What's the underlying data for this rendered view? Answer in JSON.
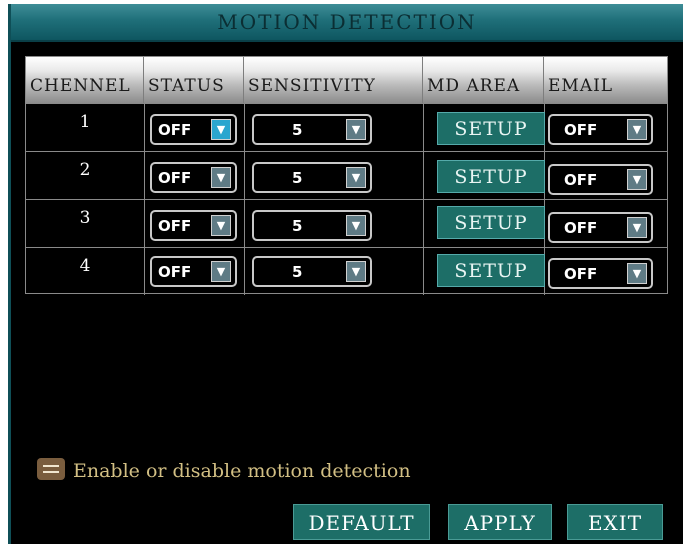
{
  "window": {
    "title": "MOTION DETECTION"
  },
  "table": {
    "columns": [
      "CHENNEL",
      "STATUS",
      "SENSITIVITY",
      "MD AREA",
      "EMAIL"
    ],
    "rows": [
      {
        "channel": "1",
        "status": "OFF",
        "sensitivity": "5",
        "md_area": "SETUP",
        "email": "OFF"
      },
      {
        "channel": "2",
        "status": "OFF",
        "sensitivity": "5",
        "md_area": "SETUP",
        "email": "OFF"
      },
      {
        "channel": "3",
        "status": "OFF",
        "sensitivity": "5",
        "md_area": "SETUP",
        "email": "OFF"
      },
      {
        "channel": "4",
        "status": "OFF",
        "sensitivity": "5",
        "md_area": "SETUP",
        "email": "OFF"
      }
    ],
    "dropdown_arrow": "▼"
  },
  "info": {
    "icon": "message-icon",
    "text": "Enable or disable motion detection"
  },
  "buttons": {
    "default": "DEFAULT",
    "apply": "APPLY",
    "exit": "EXIT"
  },
  "colors": {
    "accent": "#1d6e67",
    "title_bar": "#2f7f89",
    "active_arrow": "#2aa6cf",
    "info_text": "#d2bf84"
  }
}
